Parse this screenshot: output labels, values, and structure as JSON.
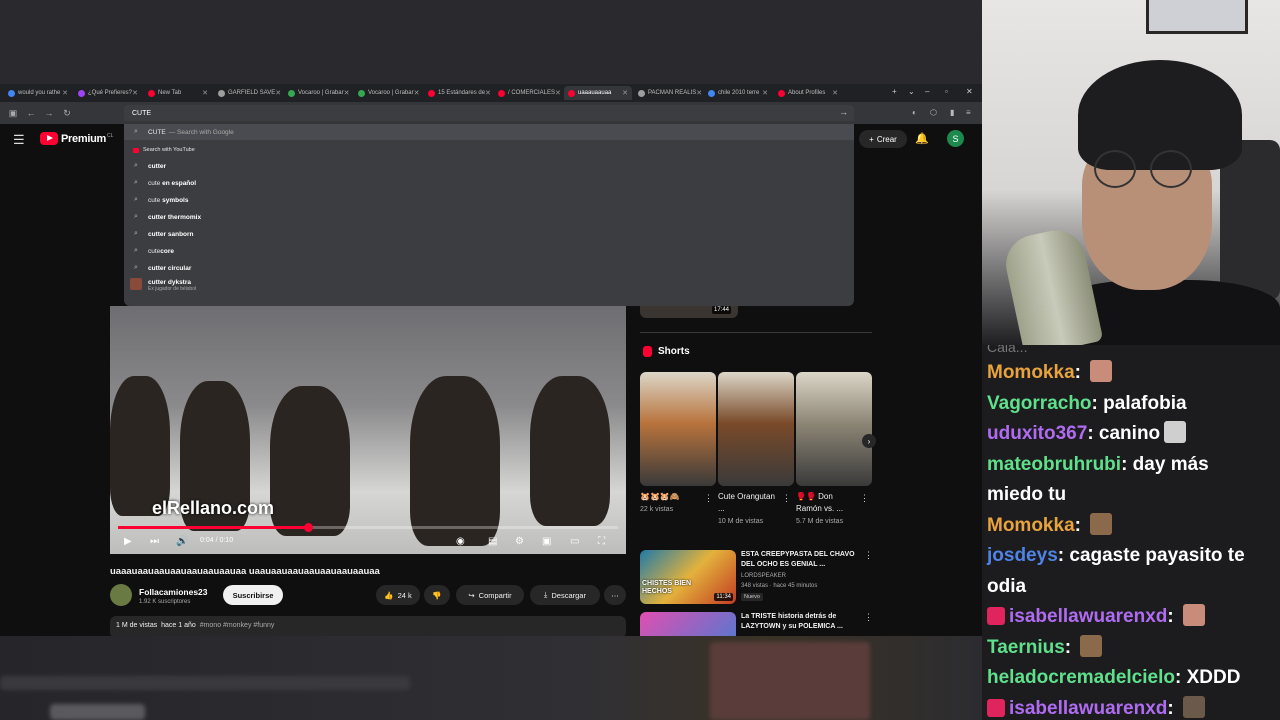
{
  "browser": {
    "tabs": [
      {
        "label": "would you rathe",
        "color": "#4285f4",
        "active": false
      },
      {
        "label": "¿Qué Prefieres?",
        "color": "#a142f4",
        "active": false
      },
      {
        "label": "New Tab",
        "color": "#ff0033",
        "active": false
      },
      {
        "label": "GARFIELD SAVE",
        "color": "#9e9e9e",
        "active": false
      },
      {
        "label": "Vocaroo | Grabar",
        "color": "#34a853",
        "active": false
      },
      {
        "label": "Vocaroo | Grabar",
        "color": "#34a853",
        "active": false
      },
      {
        "label": "15 Estándares de",
        "color": "#ff0033",
        "active": false
      },
      {
        "label": "/ COMERCIALES",
        "color": "#ff0033",
        "active": false
      },
      {
        "label": "uaaauaauaa",
        "color": "#ff0033",
        "active": true
      },
      {
        "label": "PACMAN REALIS",
        "color": "#9e9e9e",
        "active": false
      },
      {
        "label": "chile 2010 terre",
        "color": "#4285f4",
        "active": false
      },
      {
        "label": "About Profiles",
        "color": "#ff0033",
        "active": false
      }
    ],
    "new_tab": "+",
    "tab_list": "⌄",
    "window_controls": {
      "minimize": "–",
      "maximize": "▫",
      "close": "✕"
    },
    "nav": {
      "back": "←",
      "forward": "→",
      "reload": "↻"
    },
    "omnibox_value": "CUTE",
    "omnibox_go": "→",
    "nav_right_icons": [
      "◐",
      "⬡",
      "▮",
      "≡"
    ]
  },
  "dropdown": {
    "first": {
      "query": "CUTE",
      "suffix": "— Search with Google"
    },
    "search_with_youtube": "Search with YouTube",
    "suggestions": [
      {
        "prefix": "",
        "bold": "cutter",
        "sub": ""
      },
      {
        "prefix": "cute",
        "bold": " en español",
        "sub": ""
      },
      {
        "prefix": "cute",
        "bold": " symbols",
        "sub": ""
      },
      {
        "prefix": "",
        "bold": "cutter thermomix",
        "sub": ""
      },
      {
        "prefix": "",
        "bold": "cutter sanborn",
        "sub": ""
      },
      {
        "prefix": "cute",
        "bold": "core",
        "sub": ""
      },
      {
        "prefix": "",
        "bold": "cutter circular",
        "sub": ""
      },
      {
        "prefix": "",
        "bold": "cutter dykstra",
        "sub": "Ex jugador de béisbol"
      }
    ]
  },
  "youtube": {
    "menu_icon": "☰",
    "logo_text": "Premium",
    "logo_cc": "CL",
    "create": "Crear",
    "create_icon": "+",
    "bell_icon": "🔔",
    "avatar_letter": "S"
  },
  "player": {
    "watermark": "elRellano.com",
    "current_time": "0:04",
    "duration": "0:10",
    "progress": 0.38,
    "controls": {
      "play": "▶",
      "next": "⏭",
      "volume": "🔊",
      "settings": "⚙",
      "miniplayer": "▣",
      "theater": "▭",
      "fullscreen": "⛶",
      "subtitles": "▤",
      "autoplay": "◉"
    }
  },
  "video": {
    "title": "uaaauaauaauaauaauaauaauaa uaauaauaauaauaauaauaauaa",
    "channel": "Follacamiones23",
    "subscribers": "1.92 K suscriptores",
    "subscribe": "Suscribirse",
    "likes": "24 k",
    "share": "Compartir",
    "download": "Descargar",
    "more": "⋯",
    "views": "1 M de vistas",
    "age": "hace 1 año",
    "tags": "#mono #monkey #funny"
  },
  "sidebar": {
    "top_duration": "17:44",
    "shorts_heading": "Shorts",
    "shorts": [
      {
        "title": "🐹🐹🐹🙈",
        "views": "22 k vistas",
        "color": "#b8733c"
      },
      {
        "title": "Cute Orangutan ...",
        "views": "10 M de vistas",
        "color": "#7a4a2a"
      },
      {
        "title": "🥊🥊 Don Ramón vs. ...",
        "views": "5.7 M de vistas",
        "color": "#8d8676"
      }
    ],
    "shorts_next": "›",
    "recommended": [
      {
        "title": "ESTA CREEPYPASTA DEL CHAVO DEL OCHO ES GENIAL ...",
        "channel": "LORDSPEAKER",
        "meta": "348 vistas · hace 45 minutos",
        "badge": "Nuevo",
        "duration": "11:34",
        "thumb_text": "CHISTES BIEN HECHOS"
      },
      {
        "title": "La TRISTE historia detrás de LAZYTOWN y su POLEMICA ...",
        "channel": "",
        "meta": "",
        "badge": "",
        "duration": "",
        "thumb_text": ""
      }
    ]
  },
  "chat": {
    "cut_off_text": "Cala...",
    "messages": [
      {
        "user": "Momokka",
        "color": "#e8a33d",
        "text": "",
        "emote": true,
        "badge": false
      },
      {
        "user": "Vagorracho",
        "color": "#5fe08b",
        "text": "palafobia",
        "emote": false,
        "badge": false
      },
      {
        "user": "uduxito367",
        "color": "#b06cf0",
        "text": "canino",
        "emote": true,
        "badge": false
      },
      {
        "user": "mateobruhrubi",
        "color": "#5fe08b",
        "text": "day más",
        "emote": false,
        "badge": false
      },
      {
        "user": "",
        "color": "#ffffff",
        "text": "miedo tu",
        "emote": false,
        "badge": false
      },
      {
        "user": "Momokka",
        "color": "#e8a33d",
        "text": "",
        "emote": true,
        "badge": false
      },
      {
        "user": "josdeys",
        "color": "#4f83e6",
        "text": "cagaste payasito te",
        "emote": false,
        "badge": false
      },
      {
        "user": "",
        "color": "#ffffff",
        "text": "odia",
        "emote": false,
        "badge": false
      },
      {
        "user": "isabellawuarenxd",
        "color": "#b06cf0",
        "text": "",
        "emote": true,
        "badge": true
      },
      {
        "user": "Taernius",
        "color": "#5fe08b",
        "text": "",
        "emote": true,
        "badge": false
      },
      {
        "user": "heladocremadelcielo",
        "color": "#5fe08b",
        "text": "XDDD",
        "emote": false,
        "badge": false
      },
      {
        "user": "isabellawuarenxd",
        "color": "#b06cf0",
        "text": "",
        "emote": true,
        "badge": true
      }
    ]
  }
}
